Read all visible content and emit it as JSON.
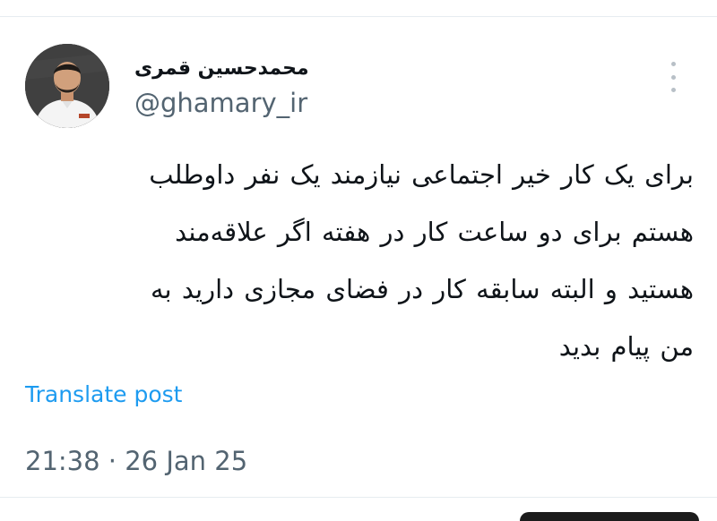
{
  "tweet": {
    "author": {
      "display_name": "محمدحسین قمری",
      "handle": "@ghamary_ir"
    },
    "text": "برای یک کار خیر اجتماعی نیازمند یک نفر داوطلب\nهستم برای دو ساعت کار در هفته اگر علاقه‌مند\nهستید و البته سابقه کار در فضای مجازی دارید به\nمن پیام بدید",
    "translate_label": "Translate post",
    "timestamp": "21:38 · 26 Jan 25"
  },
  "icons": {
    "more": "more-vertical-icon"
  },
  "colors": {
    "link": "#1d9bf0",
    "secondary_text": "#536471",
    "primary_text": "#0f1419",
    "divider": "#e6ecf0"
  }
}
